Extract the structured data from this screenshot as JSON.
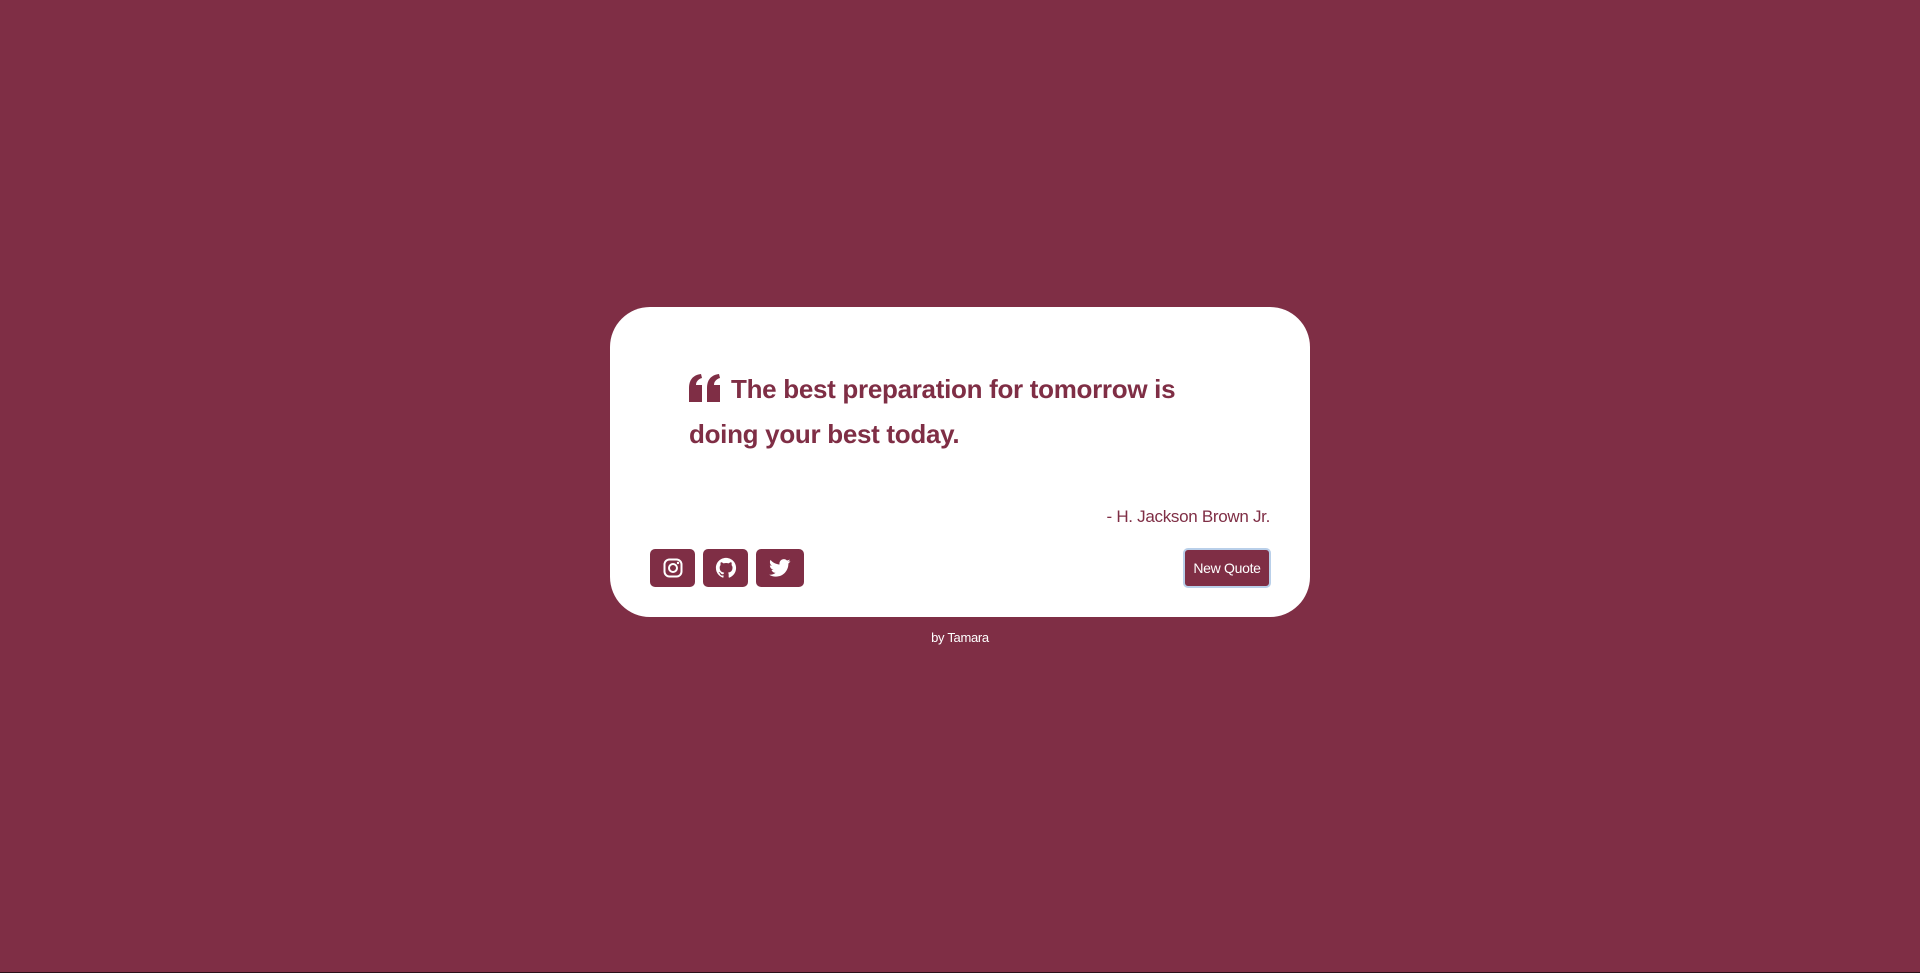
{
  "colors": {
    "background": "#7f2e45",
    "card": "#ffffff",
    "accent": "#7f2e45",
    "button_text": "#ffffff",
    "focus_ring": "#b9cfe9"
  },
  "quote": {
    "icon": "quote-left-icon",
    "text": "The best preparation for tomorrow is doing your best today.",
    "author": "- H. Jackson Brown Jr."
  },
  "social": [
    {
      "name": "instagram",
      "icon": "instagram-icon"
    },
    {
      "name": "github",
      "icon": "github-icon"
    },
    {
      "name": "twitter",
      "icon": "twitter-icon"
    }
  ],
  "actions": {
    "new_quote_label": "New Quote"
  },
  "footer": {
    "credit": "by Tamara"
  }
}
